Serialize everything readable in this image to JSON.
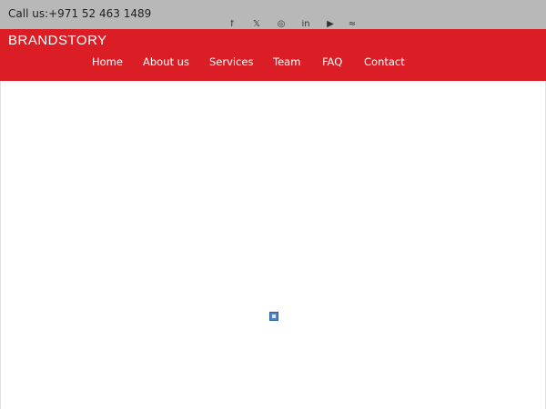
{
  "topbar": {
    "phone": "Call us:+971 52 463 1489",
    "social_icons": [
      "facebook-icon",
      "twitter-icon",
      "instagram-icon",
      "linkedin-icon",
      "youtube-icon",
      "rss-icon"
    ],
    "social_glyphs": [
      "f",
      "𝕏",
      "◎",
      "in",
      "▶",
      "≈"
    ]
  },
  "header": {
    "brand": "BRANDSTORY"
  },
  "nav": {
    "home": "Home",
    "about": "About us",
    "services": "Services",
    "team": "Team",
    "faq": "FAQ",
    "contact": "Contact"
  },
  "content": {
    "image_state": "broken-image-icon"
  },
  "colors": {
    "topbar": "#b8b8b8",
    "navbar": "#db1e26",
    "text_light": "#ffffff",
    "text_dark": "#1f1f1f"
  }
}
